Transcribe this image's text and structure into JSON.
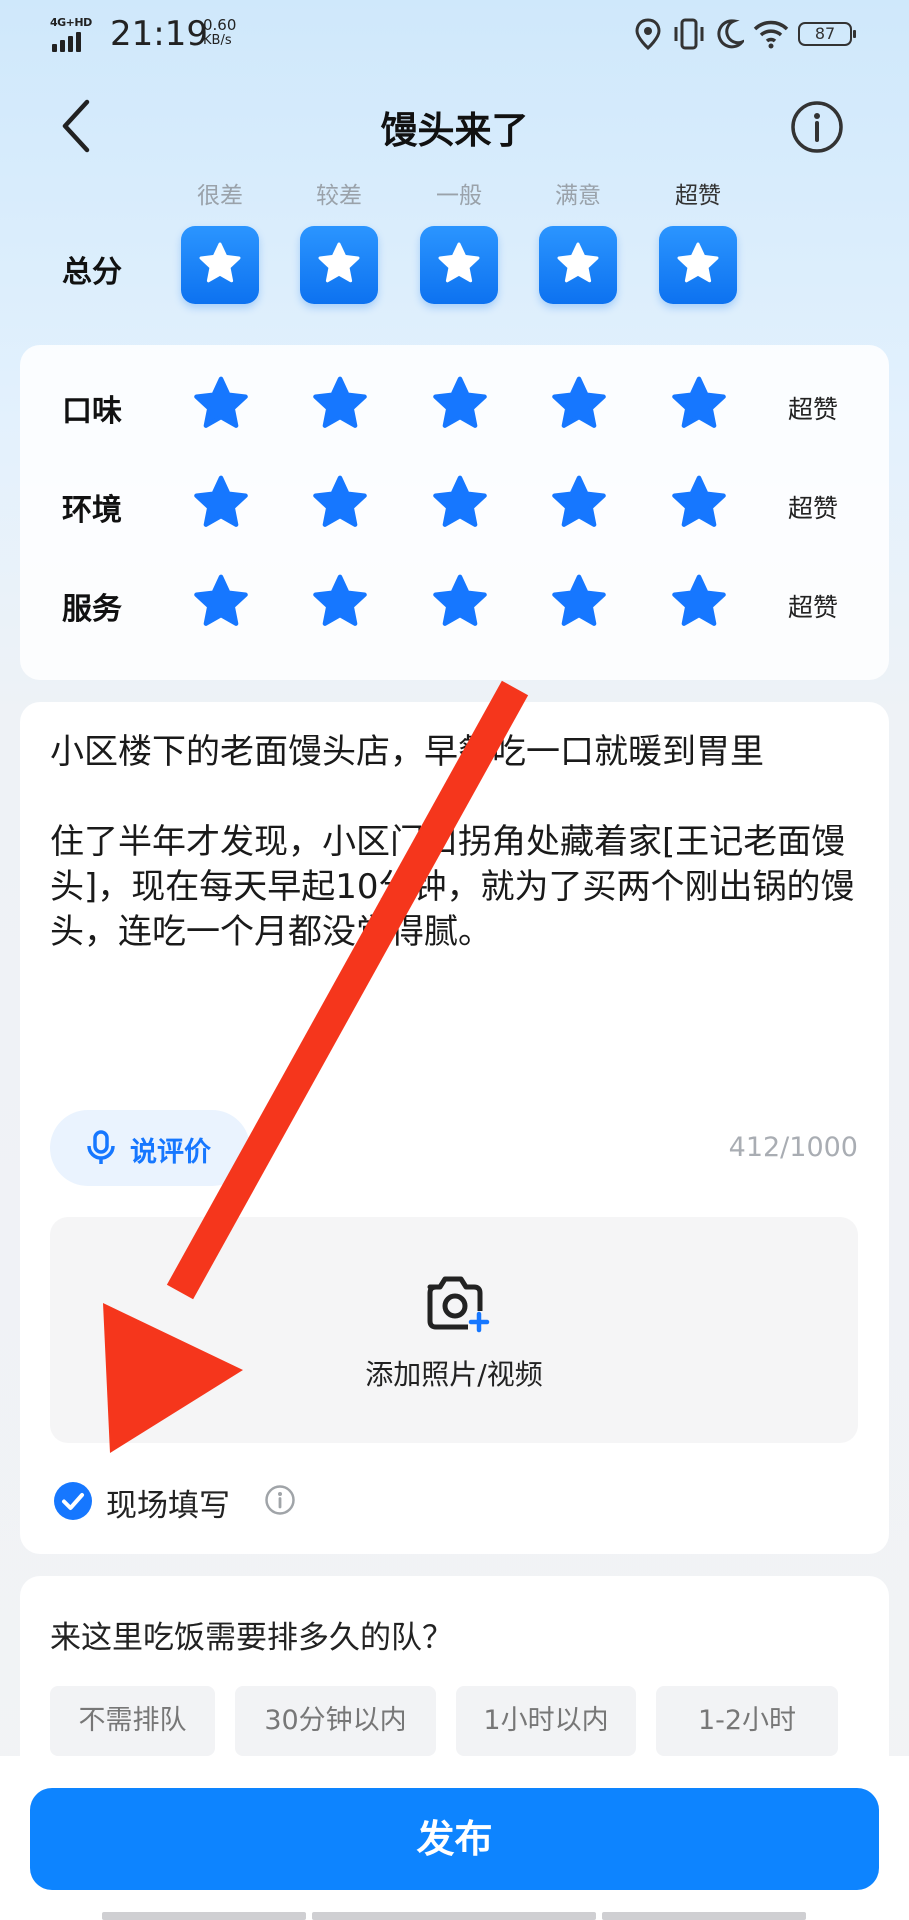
{
  "status_bar": {
    "network": "4G+HD",
    "time": "21:19",
    "speed_value": "0.60",
    "speed_unit": "KB/s",
    "battery": "87",
    "icons": [
      "location-icon",
      "vibrate-icon",
      "moon-icon",
      "wifi-icon",
      "battery-icon"
    ]
  },
  "header": {
    "title": "馒头来了"
  },
  "rating": {
    "levels": [
      "很差",
      "较差",
      "一般",
      "满意",
      "超赞"
    ],
    "overall_label": "总分",
    "overall_stars": 5,
    "sub_ratings": [
      {
        "label": "口味",
        "stars": 5,
        "level": "超赞"
      },
      {
        "label": "环境",
        "stars": 5,
        "level": "超赞"
      },
      {
        "label": "服务",
        "stars": 5,
        "level": "超赞"
      }
    ]
  },
  "review": {
    "text": "小区楼下的老面馒头店，早餐吃一口就暖到胃里\n\n住了半年才发现，小区门口拐角处藏着家[王记老面馒头]，现在每天早起10分钟，就为了买两个刚出锅的馒头，连吃一个月都没觉得腻。",
    "voice_label": "说评价",
    "char_count": "412/1000",
    "upload_label": "添加照片/视频",
    "onsite_label": "现场填写",
    "onsite_checked": true
  },
  "queue": {
    "question": "来这里吃饭需要排多久的队？",
    "options": [
      "不需排队",
      "30分钟以内",
      "1小时以内",
      "1-2小时"
    ]
  },
  "publish_label": "发布",
  "colors": {
    "accent": "#1677ff",
    "publish": "#0d84ff",
    "star": "#1677ff",
    "arrow": "#f5361c"
  }
}
